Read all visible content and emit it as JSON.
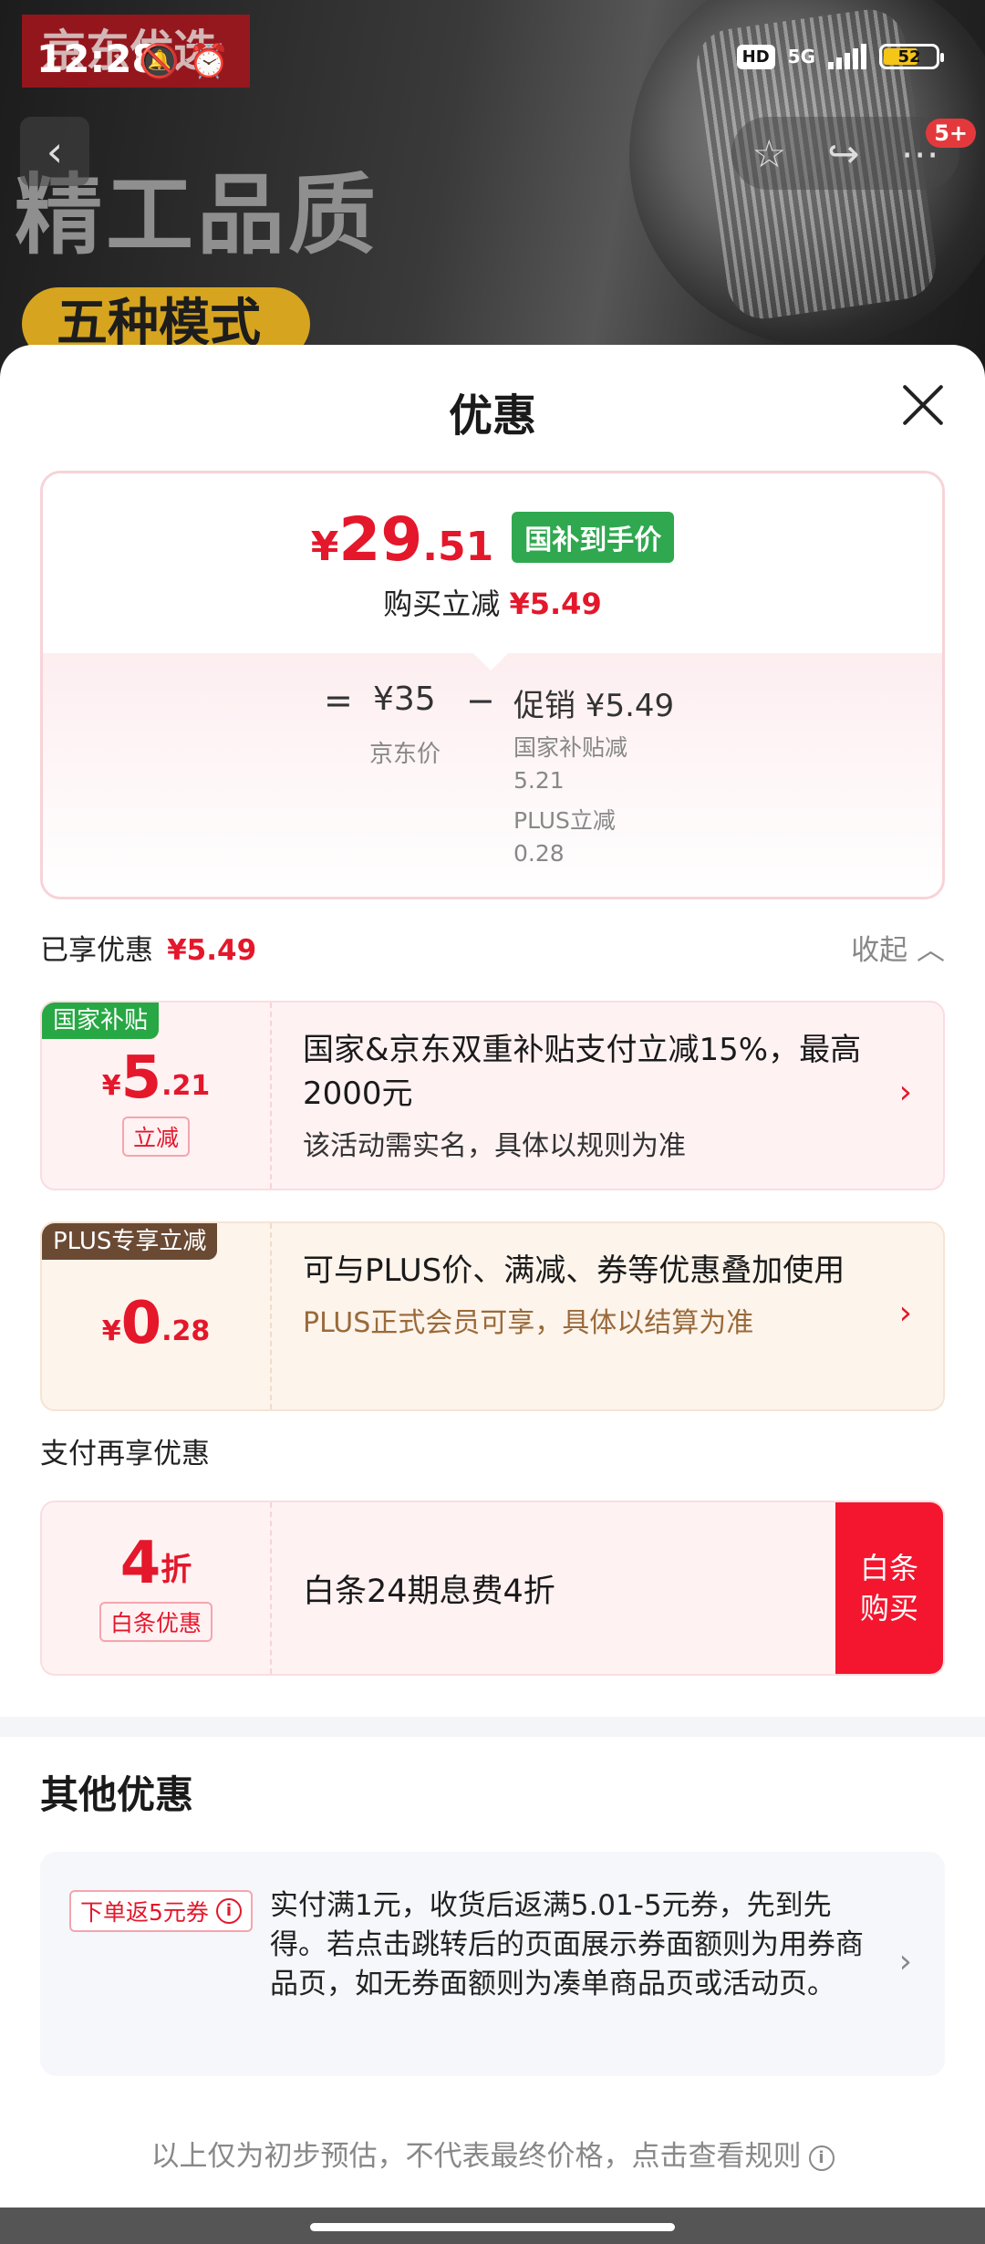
{
  "status_bar": {
    "time": "12:28",
    "hd": "HD",
    "network": "5G",
    "battery": "52"
  },
  "background": {
    "brand_text": "京东优选",
    "headline": "精工品质",
    "mode_pill": "五种模式"
  },
  "nav": {
    "badge": "5+"
  },
  "sheet": {
    "title": "优惠"
  },
  "price_card": {
    "yen": "¥",
    "price_int": "29",
    "price_dec": ".51",
    "badge": "国补到手价",
    "sub_label": "购买立减",
    "sub_amount": "¥5.49",
    "equals": "=",
    "base_price": "¥35",
    "base_label": "京东价",
    "minus": "−",
    "promo": "促销 ¥5.49",
    "details": [
      {
        "label": "国家补贴减",
        "value": "5.21"
      },
      {
        "label": "PLUS立减",
        "value": "0.28"
      }
    ]
  },
  "enjoyed": {
    "label": "已享优惠",
    "amount": "¥5.49",
    "collapse": "收起"
  },
  "coupons": [
    {
      "tag": "国家补贴",
      "yen": "¥",
      "int": "5",
      "dec": ".21",
      "mini_tag": "立减",
      "title": "国家&京东双重补贴支付立减15%，最高2000元",
      "desc": "该活动需实名，具体以规则为准"
    },
    {
      "tag": "PLUS专享立减",
      "yen": "¥",
      "int": "0",
      "dec": ".28",
      "title": "可与PLUS价、满减、券等优惠叠加使用",
      "desc": "PLUS正式会员可享，具体以结算为准"
    }
  ],
  "pay_section": {
    "label": "支付再享优惠",
    "value_int": "4",
    "value_unit": "折",
    "mini_tag": "白条优惠",
    "title": "白条24期息费4折",
    "buy_line1": "白条",
    "buy_line2": "购买"
  },
  "other": {
    "title": "其他优惠",
    "tag": "下单返5元券",
    "text": "实付满1元，收货后返满5.01-5元券，先到先得。若点击跳转后的页面展示券面额则为用券商品页，如无券面额则为凑单商品页或活动页。"
  },
  "footer": {
    "note": "以上仅为初步预估，不代表最终价格，点击查看规则"
  },
  "colors": {
    "accent_red": "#e4172b",
    "green_badge": "#2fa84f",
    "plus_brown": "#6b4a34"
  }
}
